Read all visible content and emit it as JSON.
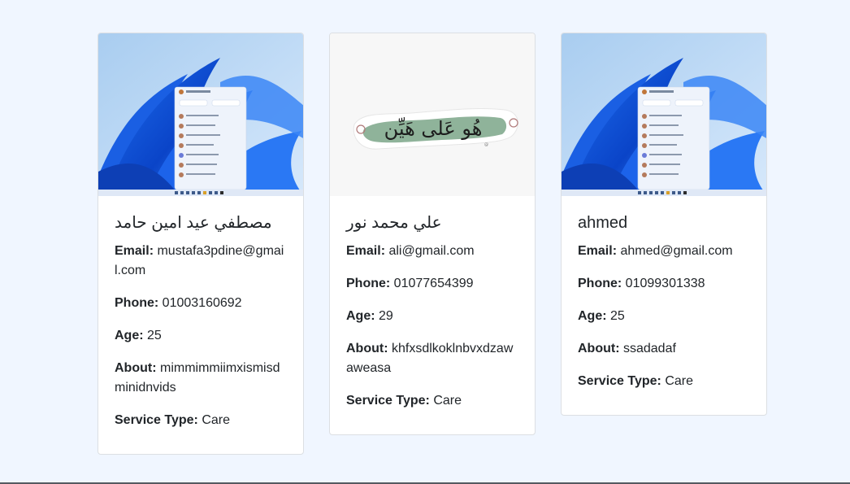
{
  "cards": [
    {
      "image": "windows-11-bloom-wallpaper",
      "name": "مصطفي عيد امين حامد",
      "email_label": "Email:",
      "email": "mustafa3pdine@gmail.com",
      "phone_label": "Phone:",
      "phone": "01003160692",
      "age_label": "Age:",
      "age": "25",
      "about_label": "About:",
      "about": "mimmimmiimxismisdminidnvids",
      "service_label": "Service Type:",
      "service": "Care"
    },
    {
      "image": "arabic-calligraphy-sticker",
      "image_text": "هُو عَلى هَيِّن",
      "name": "علي محمد نور",
      "email_label": "Email:",
      "email": "ali@gmail.com",
      "phone_label": "Phone:",
      "phone": "01077654399",
      "age_label": "Age:",
      "age": "29",
      "about_label": "About:",
      "about": "khfxsdlkoklnbvxdzawaweasa",
      "service_label": "Service Type:",
      "service": "Care"
    },
    {
      "image": "windows-11-bloom-wallpaper",
      "name": "ahmed",
      "email_label": "Email:",
      "email": "ahmed@gmail.com",
      "phone_label": "Phone:",
      "phone": "01099301338",
      "age_label": "Age:",
      "age": "25",
      "about_label": "About:",
      "about": "ssadadaf",
      "service_label": "Service Type:",
      "service": "Care"
    }
  ],
  "colors": {
    "page_background": "#f0f6ff",
    "card_background": "#ffffff",
    "text": "#212529"
  }
}
